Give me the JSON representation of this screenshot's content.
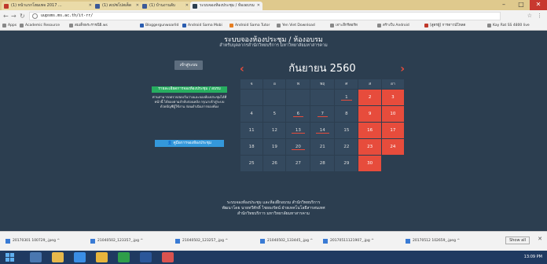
{
  "browser": {
    "tabs": [
      {
        "label": "(1) หน้าแรกโฮมเพจ 2017 ..."
      },
      {
        "label": "(1) สเปซโปสเต็ด"
      },
      {
        "label": "(1) บ้านงานลับ"
      },
      {
        "label": "ระบบจองห้องประชุม / ห้องอบรม"
      }
    ],
    "url": "uupsms.ms.ac.th/it-rr/",
    "bookmarks": [
      "Apps",
      "Academic Resource",
      "สมเด็จพระราชนิธิ.ws",
      "Bloggergunwoarlld",
      "Android Sama Mobi",
      "Android Sama Tutor",
      "Yen Viet Download",
      "เจาะลึกรีสอร์ท",
      "สร้างใบ Android",
      "[สูตรผู้] การดาวน์โหลด",
      "Kay Rat SS 4800 live"
    ]
  },
  "page": {
    "title": "ระบบจองห้องประชุม / ห้องอบรม",
    "subtitle": "สำหรับบุคลากรสำนักวิทยบริการ มหาวิทยาลัยมหาสารคาม",
    "login_label": "เข้าสู่ระบบ",
    "booking_button": "รายละเอียดการจองห้องประชุม / อบรม",
    "description": "ท่านสามารถตรวจสอบวันว่างและจองห้องประชุมได้ที่หน้านี้ ได้จองตามลำดับก่อนหลัง กรุณาเข้าสู่ระบบด้วยบัญชีผู้ใช้งาน ก่อนดำเนินการจองห้อง",
    "manual_button": "คู่มือการจองห้องประชุม",
    "footer_lines": [
      "ระบบจองห้องประชุม และห้องฝึกอบรม สำนักวิทยบริการ",
      "พัฒนาโดย นายทวีศักดิ์ ไชยธงรัตน์ ฝ่ายเทคโนโลยีสารสนเทศ",
      "สำนักวิทยบริการ มหาวิทยาลัยมหาสารคาม"
    ]
  },
  "calendar": {
    "month_title": "กันยายน 2560",
    "prev_glyph": "‹",
    "next_glyph": "›",
    "weekdays": [
      "จ",
      "อ",
      "พ",
      "พฤ",
      "ศ",
      "ส",
      "อา"
    ],
    "weeks": [
      [
        "",
        "",
        "",
        "",
        "1",
        "2",
        "3"
      ],
      [
        "4",
        "5",
        "6",
        "7",
        "8",
        "9",
        "10"
      ],
      [
        "11",
        "12",
        "13",
        "14",
        "15",
        "16",
        "17"
      ],
      [
        "18",
        "19",
        "20",
        "21",
        "22",
        "23",
        "24"
      ],
      [
        "25",
        "26",
        "27",
        "28",
        "29",
        "30",
        ""
      ]
    ],
    "booked_days": [
      "1",
      "6",
      "7",
      "13",
      "14",
      "20"
    ],
    "colors": {
      "weekend": "#e74c3c",
      "cell": "#34495e",
      "accent": "#e74c3c"
    }
  },
  "downloads": [
    {
      "name": "20170301 100729_.jpeg"
    },
    {
      "name": "21040502_123357_.jpg"
    },
    {
      "name": "21040502_123257_.jpg"
    },
    {
      "name": "21040502_133445_.jpg"
    },
    {
      "name": "20170511121907_.jpg"
    },
    {
      "name": "20170512 102659_.jpeg"
    }
  ],
  "shelf": {
    "show_all": "Show all"
  },
  "taskbar": {
    "time": "13:09 PM"
  }
}
